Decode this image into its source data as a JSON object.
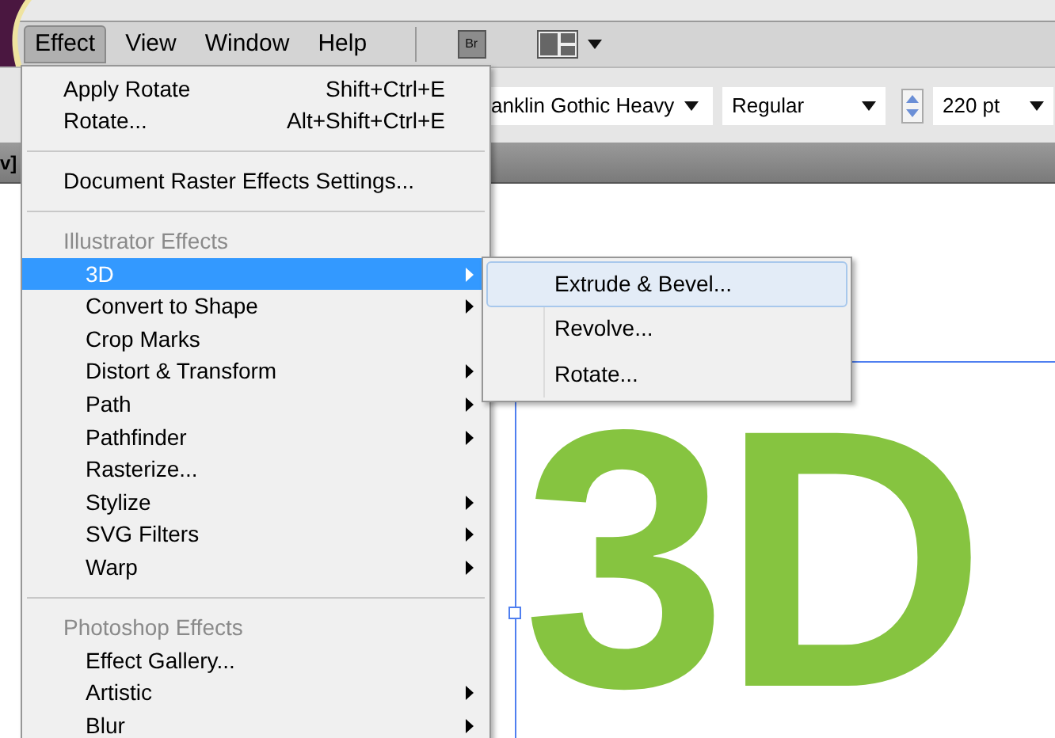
{
  "menu_bar": {
    "items": [
      {
        "label": "Effect",
        "selected": true
      },
      {
        "label": "View",
        "selected": false
      },
      {
        "label": "Window",
        "selected": false
      },
      {
        "label": "Help",
        "selected": false
      }
    ]
  },
  "bridge_button": {
    "label": "Br"
  },
  "control_bar": {
    "font_family": "anklin Gothic Heavy",
    "font_style": "Regular",
    "font_size": "220 pt"
  },
  "document_tab": {
    "label": "v]"
  },
  "canvas": {
    "text": "3D"
  },
  "effect_menu": {
    "items": [
      {
        "kind": "item",
        "label": "Apply Rotate",
        "shortcut": "Shift+Ctrl+E",
        "selected": false,
        "submenu": false,
        "indent": false
      },
      {
        "kind": "item",
        "label": "Rotate...",
        "shortcut": "Alt+Shift+Ctrl+E",
        "selected": false,
        "submenu": false,
        "indent": false
      },
      {
        "kind": "separator"
      },
      {
        "kind": "item",
        "label": "Document Raster Effects Settings...",
        "selected": false,
        "submenu": false,
        "indent": false
      },
      {
        "kind": "separator"
      },
      {
        "kind": "header",
        "label": "Illustrator Effects"
      },
      {
        "kind": "item",
        "label": "3D",
        "selected": true,
        "submenu": true,
        "indent": true
      },
      {
        "kind": "item",
        "label": "Convert to Shape",
        "selected": false,
        "submenu": true,
        "indent": true
      },
      {
        "kind": "item",
        "label": "Crop Marks",
        "selected": false,
        "submenu": false,
        "indent": true
      },
      {
        "kind": "item",
        "label": "Distort & Transform",
        "selected": false,
        "submenu": true,
        "indent": true
      },
      {
        "kind": "item",
        "label": "Path",
        "selected": false,
        "submenu": true,
        "indent": true
      },
      {
        "kind": "item",
        "label": "Pathfinder",
        "selected": false,
        "submenu": true,
        "indent": true
      },
      {
        "kind": "item",
        "label": "Rasterize...",
        "selected": false,
        "submenu": false,
        "indent": true
      },
      {
        "kind": "item",
        "label": "Stylize",
        "selected": false,
        "submenu": true,
        "indent": true
      },
      {
        "kind": "item",
        "label": "SVG Filters",
        "selected": false,
        "submenu": true,
        "indent": true
      },
      {
        "kind": "item",
        "label": "Warp",
        "selected": false,
        "submenu": true,
        "indent": true
      },
      {
        "kind": "separator"
      },
      {
        "kind": "header",
        "label": "Photoshop Effects"
      },
      {
        "kind": "item",
        "label": "Effect Gallery...",
        "selected": false,
        "submenu": false,
        "indent": true
      },
      {
        "kind": "item",
        "label": "Artistic",
        "selected": false,
        "submenu": true,
        "indent": true
      },
      {
        "kind": "item",
        "label": "Blur",
        "selected": false,
        "submenu": true,
        "indent": true
      }
    ]
  },
  "submenu_3d": {
    "items": [
      {
        "label": "Extrude & Bevel...",
        "selected": true
      },
      {
        "label": "Revolve...",
        "selected": false
      },
      {
        "label": "Rotate...",
        "selected": false
      }
    ]
  }
}
